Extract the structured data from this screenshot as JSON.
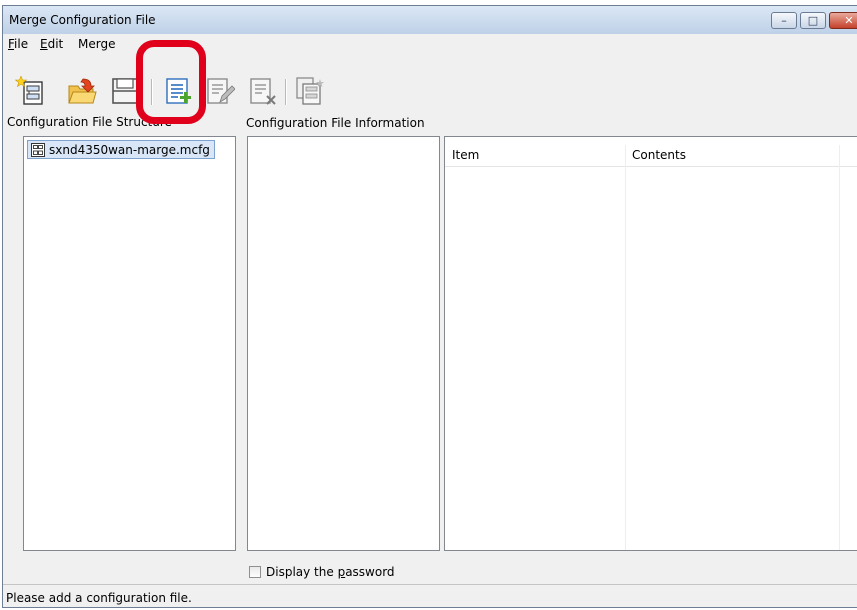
{
  "window": {
    "title": "Merge Configuration File",
    "caption_buttons": {
      "minimize": "–",
      "maximize": "□",
      "close": "✕"
    }
  },
  "menu": [
    {
      "underlined": "F",
      "rest": "ile"
    },
    {
      "underlined": "E",
      "rest": "dit"
    },
    {
      "underlined": "",
      "rest": "Merge"
    }
  ],
  "toolbar": {
    "icons": [
      "new-configuration-icon",
      "open-folder-icon",
      "save-icon",
      "add-item-icon",
      "edit-item-icon",
      "delete-item-icon",
      "copy-item-icon"
    ]
  },
  "left_panel": {
    "label": "Configuration File Structure",
    "items": [
      {
        "label": "sxnd4350wan-marge.mcfg"
      }
    ]
  },
  "middle_panel": {
    "label": "Configuration File Information"
  },
  "table": {
    "columns": [
      "Item",
      "Contents"
    ]
  },
  "options": {
    "display_password_prefix": "Display the ",
    "display_password_underlined": "p",
    "display_password_suffix": "assword",
    "display_password_checked": false
  },
  "status": {
    "message": "Please add a configuration file."
  },
  "colors": {
    "highlight": "#e0001b",
    "selection": "#d8e6f7"
  }
}
